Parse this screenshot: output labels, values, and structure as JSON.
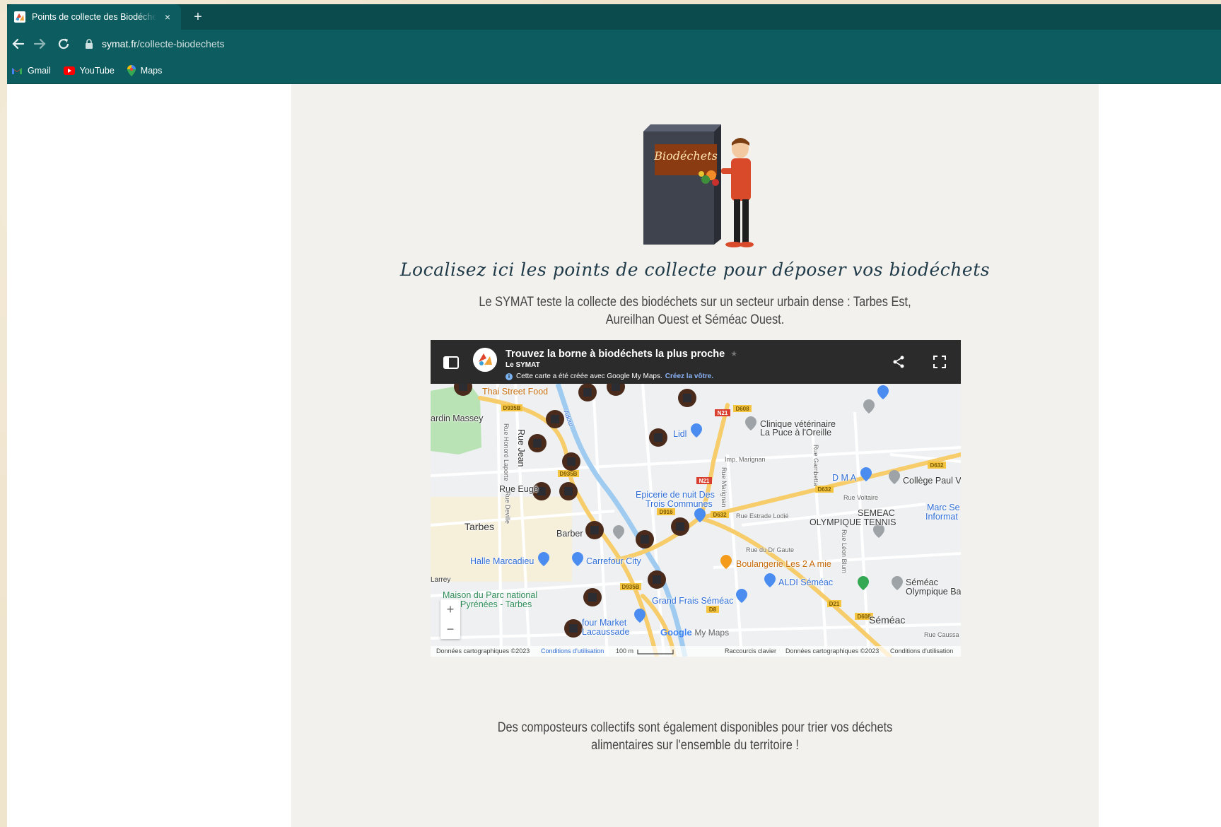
{
  "browser": {
    "tab_title": "Points de collecte des Biodéchets",
    "tab_close": "×",
    "new_tab": "+",
    "url_domain": "symat.fr",
    "url_path": "/collecte-biodechets",
    "bookmarks": [
      {
        "label": "Gmail",
        "icon": "gmail-icon"
      },
      {
        "label": "YouTube",
        "icon": "youtube-icon"
      },
      {
        "label": "Maps",
        "icon": "maps-icon"
      }
    ]
  },
  "page": {
    "illustration_text": "Biodéchets",
    "headline": "Localisez ici les points de collecte pour déposer vos biodéchets",
    "intro": "Le SYMAT teste la collecte des biodéchets sur un secteur urbain dense : Tarbes Est, Aureilhan Ouest et Séméac Ouest.",
    "outro": "Des composteurs collectifs sont également disponibles pour trier vos déchets alimentaires sur l'ensemble du territoire !"
  },
  "map": {
    "title": "Trouvez la borne à biodéchets la plus proche",
    "star": "★",
    "owner": "Le SYMAT",
    "notice": "Cette carte a été créée avec Google My Maps.",
    "notice_link": "Créez la vôtre.",
    "zoom_in": "+",
    "zoom_out": "−",
    "logo_google": "Google",
    "logo_mymaps": "My Maps",
    "footer_left_data": "Données cartographiques ©2023",
    "footer_left_terms": "Conditions d'utilisation",
    "footer_scale": "100 m",
    "footer_shortcuts": "Raccourcis clavier",
    "footer_right_data": "Données cartographiques ©2023",
    "footer_right_terms": "Conditions d'utilisation",
    "places": {
      "thai": "Thai Street Food",
      "jardin": "ardin Massey",
      "clinique_1": "Clinique vétérinaire",
      "clinique_2": "La Puce à l'Oreille",
      "lidl": "Lidl",
      "rue_eugene": "Rue Eugè",
      "tarbes": "Tarbes",
      "epicerie_1": "Epicerie de nuit Des",
      "epicerie_2": "Trois Communes",
      "barber": "Barber",
      "halle": "Halle Marcadieu",
      "carrefour_city": "Carrefour City",
      "boulangerie": "Boulangerie Les 2 A mie",
      "aldi": "ALDI Séméac",
      "larrey": "Larrey",
      "maison_1": "Maison du Parc national",
      "maison_2": "Pyrénées - Tarbes",
      "grand_frais": "Grand Frais Séméac",
      "four_market_1": "four Market",
      "four_market_2": "Lacaussade",
      "dma": "D M A",
      "college": "Collège Paul V",
      "semeac_olympique_1": "SEMEAC",
      "semeac_olympique_2": "OLYMPIQUE TENNIS",
      "marc_1": "Marc Se",
      "marc_2": "Informat",
      "semeac_bb_1": "Séméac",
      "semeac_bb_2": "Olympique Ba",
      "semeac": "Séméac",
      "rue_voltaire": "Rue Voltaire",
      "rue_estrade": "Rue Estrade Lodié",
      "imp_marignan": "Imp. Marignan",
      "rue_dr_gaute": "Rue du Dr Gaute",
      "rue_jean": "Rue Jean",
      "rue_deville": "Rue Deville",
      "rue_honore": "Rue Honoré Laporte",
      "rue_causs": "Rue Caussa",
      "rue_gambetta": "Rue Gambetta",
      "rue_leon_blum": "Rue Léon Blum",
      "rue_marignan": "Rue Marignan",
      "adour": "Adour"
    },
    "roads": [
      "D935B",
      "D935B",
      "D935B",
      "N21",
      "N21",
      "D608",
      "D632",
      "D632",
      "D632",
      "D916",
      "D8",
      "D21",
      "D608"
    ],
    "colors": {
      "water": "#9ecbef",
      "park": "#b9e3b4",
      "road_yellow": "#f7cd6b",
      "marker": "#4a2a1a"
    }
  }
}
